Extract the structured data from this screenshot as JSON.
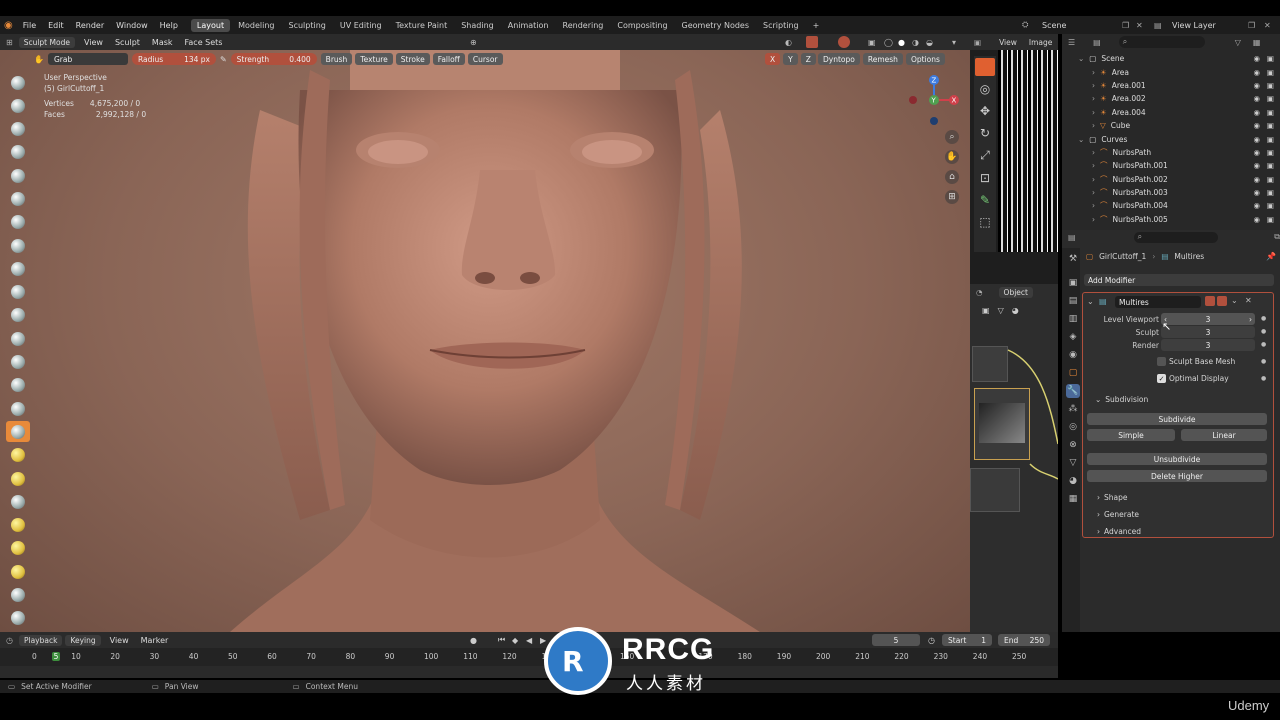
{
  "menu": [
    "File",
    "Edit",
    "Render",
    "Window",
    "Help"
  ],
  "workspaces": [
    {
      "label": "Layout",
      "active": true
    },
    {
      "label": "Modeling"
    },
    {
      "label": "Sculpting"
    },
    {
      "label": "UV Editing"
    },
    {
      "label": "Texture Paint"
    },
    {
      "label": "Shading"
    },
    {
      "label": "Animation"
    },
    {
      "label": "Rendering"
    },
    {
      "label": "Compositing"
    },
    {
      "label": "Geometry Nodes"
    },
    {
      "label": "Scripting"
    }
  ],
  "add_workspace": "+",
  "scene_label": "Scene",
  "view_layer_label": "View Layer",
  "header": {
    "mode": "Sculpt Mode",
    "items": [
      "View",
      "Sculpt",
      "Mask",
      "Face Sets"
    ]
  },
  "tool": {
    "brush_name": "Grab",
    "radius_label": "Radius",
    "radius_value": "134 px",
    "strength_label": "Strength",
    "strength_value": "0.400",
    "dropdowns": [
      "Brush",
      "Texture",
      "Stroke",
      "Falloff",
      "Cursor"
    ],
    "axes": [
      "X",
      "Y",
      "Z"
    ],
    "right_dropdowns": [
      "Dyntopo",
      "Remesh",
      "Options"
    ]
  },
  "viewport_info": {
    "perspective": "User Perspective",
    "object": "(5) GirlCuttoff_1",
    "vertices_label": "Vertices",
    "vertices_value": "4,675,200 / 0",
    "faces_label": "Faces",
    "faces_value": "2,992,128 / 0"
  },
  "image_editor": {
    "view": "View",
    "image": "Image"
  },
  "node_editor": {
    "object": "Object"
  },
  "outliner": {
    "rows": [
      {
        "name": "Scene",
        "indent": 0,
        "type": "collection"
      },
      {
        "name": "Area",
        "indent": 1,
        "type": "light"
      },
      {
        "name": "Area.001",
        "indent": 1,
        "type": "light"
      },
      {
        "name": "Area.002",
        "indent": 1,
        "type": "light"
      },
      {
        "name": "Area.004",
        "indent": 1,
        "type": "light"
      },
      {
        "name": "Cube",
        "indent": 1,
        "type": "mesh"
      },
      {
        "name": "Curves",
        "indent": 0,
        "type": "collection"
      },
      {
        "name": "NurbsPath",
        "indent": 1,
        "type": "curve"
      },
      {
        "name": "NurbsPath.001",
        "indent": 1,
        "type": "curve"
      },
      {
        "name": "NurbsPath.002",
        "indent": 1,
        "type": "curve"
      },
      {
        "name": "NurbsPath.003",
        "indent": 1,
        "type": "curve"
      },
      {
        "name": "NurbsPath.004",
        "indent": 1,
        "type": "curve"
      },
      {
        "name": "NurbsPath.005",
        "indent": 1,
        "type": "curve"
      }
    ]
  },
  "properties": {
    "breadcrumb_object": "GirlCuttoff_1",
    "breadcrumb_modifier": "Multires",
    "add_modifier": "Add Modifier",
    "modifier_name": "Multires",
    "level_viewport_label": "Level Viewport",
    "level_viewport_value": "3",
    "sculpt_label": "Sculpt",
    "sculpt_value": "3",
    "render_label": "Render",
    "render_value": "3",
    "sculpt_base_mesh": "Sculpt Base Mesh",
    "optimal_display": "Optimal Display",
    "subdivision": "Subdivision",
    "subdivide": "Subdivide",
    "simple": "Simple",
    "linear": "Linear",
    "unsubdivide": "Unsubdivide",
    "delete_higher": "Delete Higher",
    "shape": "Shape",
    "generate": "Generate",
    "advanced": "Advanced"
  },
  "timeline": {
    "playback": "Playback",
    "keying": "Keying",
    "view": "View",
    "marker": "Marker",
    "current_frame": "5",
    "start_label": "Start",
    "start_value": "1",
    "end_label": "End",
    "end_value": "250",
    "ticks": [
      "0",
      "5",
      "10",
      "20",
      "30",
      "40",
      "50",
      "60",
      "70",
      "80",
      "90",
      "100",
      "110",
      "120",
      "130",
      "150",
      "170",
      "180",
      "190",
      "200",
      "210",
      "220",
      "230",
      "240",
      "250"
    ]
  },
  "status": {
    "left": "Set Active Modifier",
    "mid": "Pan View",
    "right": "Context Menu"
  },
  "watermark": {
    "text": "RRCG",
    "subtext": "人人素材",
    "brand": "Udemy"
  },
  "colors": {
    "accent": "#e88a3a",
    "brush_red": "#b1503d",
    "active_tab": "#4b4b4b"
  }
}
